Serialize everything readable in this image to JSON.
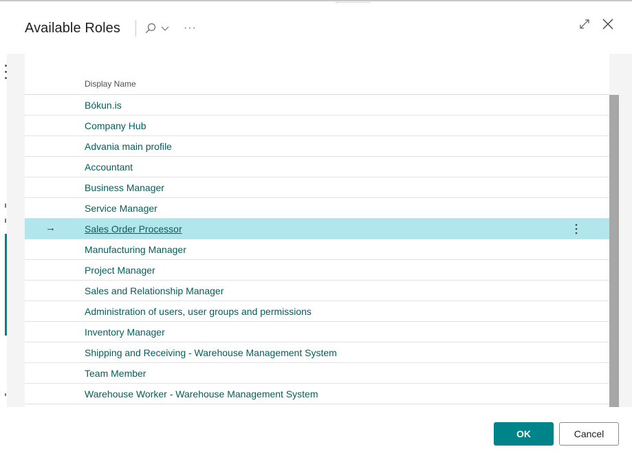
{
  "dialog": {
    "title": "Available Roles",
    "more_label": "···"
  },
  "icons": {
    "search": "search-icon",
    "chevron": "chevron-down-icon",
    "expand": "expand-icon",
    "close": "close-icon",
    "row_arrow": "arrow-right-icon",
    "row_menu": "vertical-ellipsis-icon"
  },
  "table": {
    "column_header": "Display Name",
    "selected_marker": "→",
    "rows": [
      "Bókun.is",
      "Company Hub",
      "Advania main profile",
      "Accountant",
      "Business Manager",
      "Service Manager",
      "Sales Order Processor",
      "Manufacturing Manager",
      "Project Manager",
      "Sales and Relationship Manager",
      "Administration of users, user groups and permissions",
      "Inventory Manager",
      "Shipping and Receiving - Warehouse Management System",
      "Team Member",
      "Warehouse Worker - Warehouse Management System"
    ],
    "selected_index": 6
  },
  "footer": {
    "ok_label": "OK",
    "cancel_label": "Cancel"
  },
  "colors": {
    "accent": "#008489",
    "selected_row": "#b1e6ec",
    "link_text": "#00605f"
  }
}
